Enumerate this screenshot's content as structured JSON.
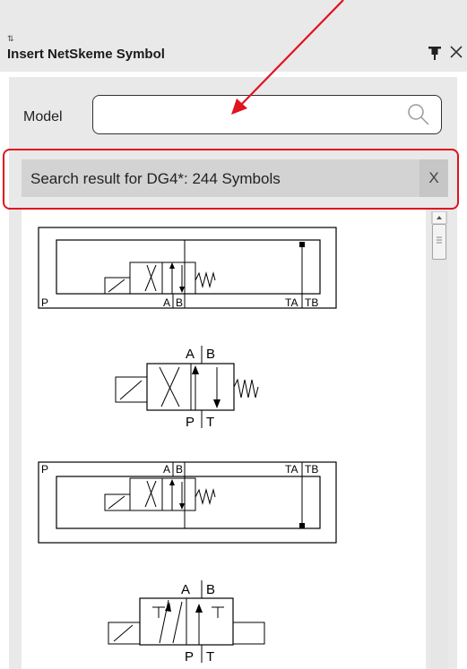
{
  "panel": {
    "title": "Insert NetSkeme Symbol",
    "pin_icon": "pin-icon",
    "close_icon": "close-icon"
  },
  "model": {
    "label": "Model",
    "value": "",
    "placeholder": ""
  },
  "search_result": {
    "text": "Search result for DG4*: 244 Symbols",
    "close_label": "X"
  },
  "symbols": [
    {
      "port_p": "P",
      "port_a": "A",
      "port_b": "B",
      "port_t1": "TA",
      "port_t2": "TB"
    },
    {
      "port_a": "A",
      "port_b": "B",
      "port_p": "P",
      "port_t": "T"
    },
    {
      "port_p": "P",
      "port_a": "A",
      "port_b": "B",
      "port_t1": "TA",
      "port_t2": "TB"
    },
    {
      "port_a": "A",
      "port_b": "B",
      "port_p": "P",
      "port_t": "T"
    }
  ],
  "colors": {
    "highlight": "#e0131e",
    "panel_bg": "#e9e9e9",
    "result_bar": "#d3d3d3"
  }
}
